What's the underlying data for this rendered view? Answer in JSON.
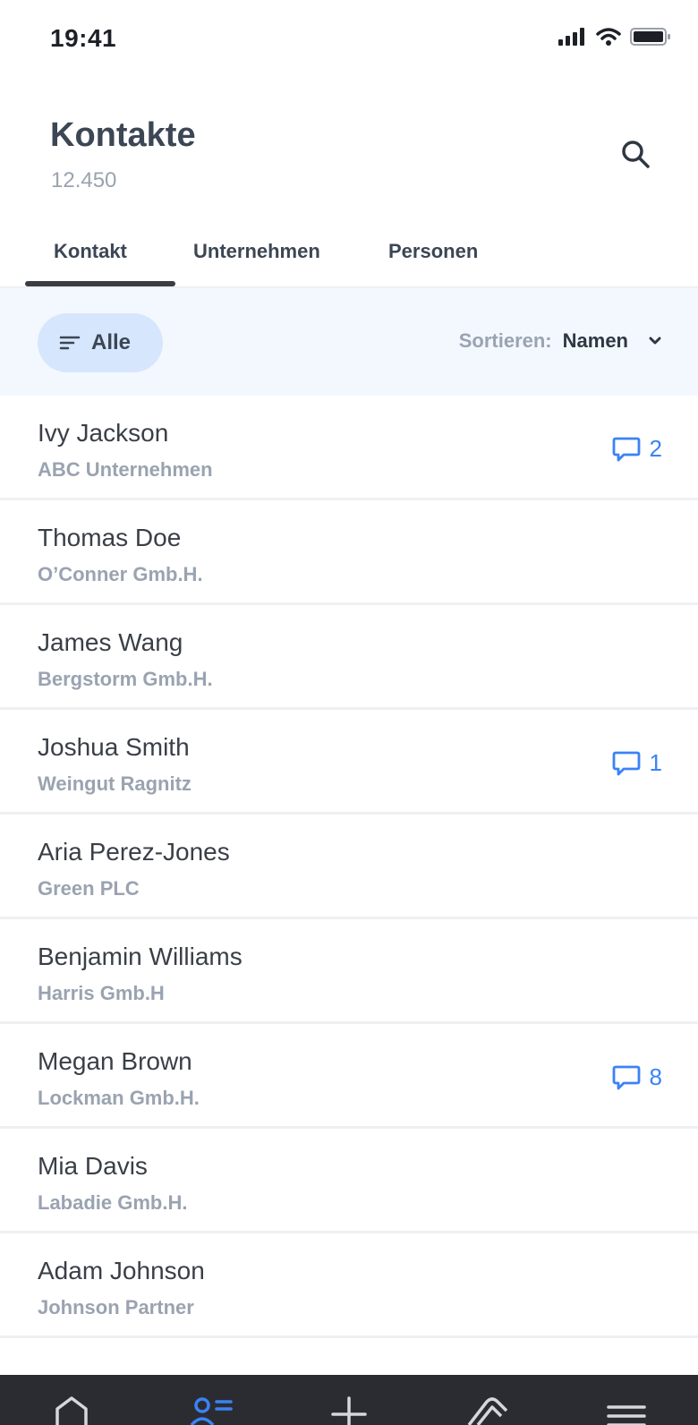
{
  "status_bar": {
    "time": "19:41"
  },
  "header": {
    "title": "Kontakte",
    "count": "12.450"
  },
  "tabs": [
    {
      "label": "Kontakt",
      "active": true
    },
    {
      "label": "Unternehmen",
      "active": false
    },
    {
      "label": "Personen",
      "active": false
    }
  ],
  "filter": {
    "chip_label": "Alle",
    "sort_label": "Sortieren:",
    "sort_value": "Namen"
  },
  "contacts": [
    {
      "name": "Ivy Jackson",
      "company": "ABC Unternehmen",
      "comments": "2"
    },
    {
      "name": "Thomas Doe",
      "company": "O’Conner Gmb.H.",
      "comments": ""
    },
    {
      "name": "James Wang",
      "company": "Bergstorm Gmb.H.",
      "comments": ""
    },
    {
      "name": "Joshua Smith",
      "company": "Weingut Ragnitz",
      "comments": "1"
    },
    {
      "name": "Aria Perez-Jones",
      "company": "Green PLC",
      "comments": ""
    },
    {
      "name": "Benjamin Williams",
      "company": "Harris Gmb.H",
      "comments": ""
    },
    {
      "name": "Megan Brown",
      "company": "Lockman Gmb.H.",
      "comments": "8"
    },
    {
      "name": "Mia Davis",
      "company": "Labadie Gmb.H.",
      "comments": ""
    },
    {
      "name": "Adam Johnson",
      "company": "Johnson Partner",
      "comments": ""
    }
  ],
  "colors": {
    "accent": "#3b82f6",
    "nav_active": "#3b82f6",
    "nav_bg": "#2b2c31",
    "filter_bg": "#f3f8ff",
    "chip_bg": "#d6e6fd"
  },
  "bottom_nav": [
    {
      "icon": "home-icon",
      "active": false
    },
    {
      "icon": "contacts-icon",
      "active": true
    },
    {
      "icon": "plus-icon",
      "active": false
    },
    {
      "icon": "tag-icon",
      "active": false
    },
    {
      "icon": "menu-icon",
      "active": false
    }
  ]
}
